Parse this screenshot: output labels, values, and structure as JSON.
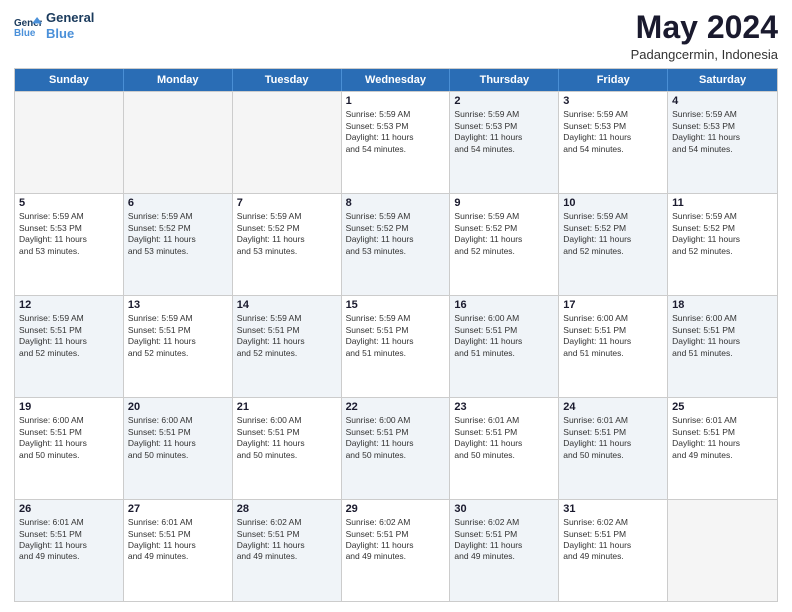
{
  "logo": {
    "line1": "General",
    "line2": "Blue"
  },
  "title": "May 2024",
  "subtitle": "Padangcermin, Indonesia",
  "days": [
    "Sunday",
    "Monday",
    "Tuesday",
    "Wednesday",
    "Thursday",
    "Friday",
    "Saturday"
  ],
  "rows": [
    [
      {
        "day": "",
        "info": "",
        "empty": true
      },
      {
        "day": "",
        "info": "",
        "empty": true
      },
      {
        "day": "",
        "info": "",
        "empty": true
      },
      {
        "day": "1",
        "info": "Sunrise: 5:59 AM\nSunset: 5:53 PM\nDaylight: 11 hours\nand 54 minutes.",
        "shade": false
      },
      {
        "day": "2",
        "info": "Sunrise: 5:59 AM\nSunset: 5:53 PM\nDaylight: 11 hours\nand 54 minutes.",
        "shade": true
      },
      {
        "day": "3",
        "info": "Sunrise: 5:59 AM\nSunset: 5:53 PM\nDaylight: 11 hours\nand 54 minutes.",
        "shade": false
      },
      {
        "day": "4",
        "info": "Sunrise: 5:59 AM\nSunset: 5:53 PM\nDaylight: 11 hours\nand 54 minutes.",
        "shade": true
      }
    ],
    [
      {
        "day": "5",
        "info": "Sunrise: 5:59 AM\nSunset: 5:53 PM\nDaylight: 11 hours\nand 53 minutes.",
        "shade": false
      },
      {
        "day": "6",
        "info": "Sunrise: 5:59 AM\nSunset: 5:52 PM\nDaylight: 11 hours\nand 53 minutes.",
        "shade": true
      },
      {
        "day": "7",
        "info": "Sunrise: 5:59 AM\nSunset: 5:52 PM\nDaylight: 11 hours\nand 53 minutes.",
        "shade": false
      },
      {
        "day": "8",
        "info": "Sunrise: 5:59 AM\nSunset: 5:52 PM\nDaylight: 11 hours\nand 53 minutes.",
        "shade": true
      },
      {
        "day": "9",
        "info": "Sunrise: 5:59 AM\nSunset: 5:52 PM\nDaylight: 11 hours\nand 52 minutes.",
        "shade": false
      },
      {
        "day": "10",
        "info": "Sunrise: 5:59 AM\nSunset: 5:52 PM\nDaylight: 11 hours\nand 52 minutes.",
        "shade": true
      },
      {
        "day": "11",
        "info": "Sunrise: 5:59 AM\nSunset: 5:52 PM\nDaylight: 11 hours\nand 52 minutes.",
        "shade": false
      }
    ],
    [
      {
        "day": "12",
        "info": "Sunrise: 5:59 AM\nSunset: 5:51 PM\nDaylight: 11 hours\nand 52 minutes.",
        "shade": true
      },
      {
        "day": "13",
        "info": "Sunrise: 5:59 AM\nSunset: 5:51 PM\nDaylight: 11 hours\nand 52 minutes.",
        "shade": false
      },
      {
        "day": "14",
        "info": "Sunrise: 5:59 AM\nSunset: 5:51 PM\nDaylight: 11 hours\nand 52 minutes.",
        "shade": true
      },
      {
        "day": "15",
        "info": "Sunrise: 5:59 AM\nSunset: 5:51 PM\nDaylight: 11 hours\nand 51 minutes.",
        "shade": false
      },
      {
        "day": "16",
        "info": "Sunrise: 6:00 AM\nSunset: 5:51 PM\nDaylight: 11 hours\nand 51 minutes.",
        "shade": true
      },
      {
        "day": "17",
        "info": "Sunrise: 6:00 AM\nSunset: 5:51 PM\nDaylight: 11 hours\nand 51 minutes.",
        "shade": false
      },
      {
        "day": "18",
        "info": "Sunrise: 6:00 AM\nSunset: 5:51 PM\nDaylight: 11 hours\nand 51 minutes.",
        "shade": true
      }
    ],
    [
      {
        "day": "19",
        "info": "Sunrise: 6:00 AM\nSunset: 5:51 PM\nDaylight: 11 hours\nand 50 minutes.",
        "shade": false
      },
      {
        "day": "20",
        "info": "Sunrise: 6:00 AM\nSunset: 5:51 PM\nDaylight: 11 hours\nand 50 minutes.",
        "shade": true
      },
      {
        "day": "21",
        "info": "Sunrise: 6:00 AM\nSunset: 5:51 PM\nDaylight: 11 hours\nand 50 minutes.",
        "shade": false
      },
      {
        "day": "22",
        "info": "Sunrise: 6:00 AM\nSunset: 5:51 PM\nDaylight: 11 hours\nand 50 minutes.",
        "shade": true
      },
      {
        "day": "23",
        "info": "Sunrise: 6:01 AM\nSunset: 5:51 PM\nDaylight: 11 hours\nand 50 minutes.",
        "shade": false
      },
      {
        "day": "24",
        "info": "Sunrise: 6:01 AM\nSunset: 5:51 PM\nDaylight: 11 hours\nand 50 minutes.",
        "shade": true
      },
      {
        "day": "25",
        "info": "Sunrise: 6:01 AM\nSunset: 5:51 PM\nDaylight: 11 hours\nand 49 minutes.",
        "shade": false
      }
    ],
    [
      {
        "day": "26",
        "info": "Sunrise: 6:01 AM\nSunset: 5:51 PM\nDaylight: 11 hours\nand 49 minutes.",
        "shade": true
      },
      {
        "day": "27",
        "info": "Sunrise: 6:01 AM\nSunset: 5:51 PM\nDaylight: 11 hours\nand 49 minutes.",
        "shade": false
      },
      {
        "day": "28",
        "info": "Sunrise: 6:02 AM\nSunset: 5:51 PM\nDaylight: 11 hours\nand 49 minutes.",
        "shade": true
      },
      {
        "day": "29",
        "info": "Sunrise: 6:02 AM\nSunset: 5:51 PM\nDaylight: 11 hours\nand 49 minutes.",
        "shade": false
      },
      {
        "day": "30",
        "info": "Sunrise: 6:02 AM\nSunset: 5:51 PM\nDaylight: 11 hours\nand 49 minutes.",
        "shade": true
      },
      {
        "day": "31",
        "info": "Sunrise: 6:02 AM\nSunset: 5:51 PM\nDaylight: 11 hours\nand 49 minutes.",
        "shade": false
      },
      {
        "day": "",
        "info": "",
        "empty": true
      }
    ]
  ]
}
